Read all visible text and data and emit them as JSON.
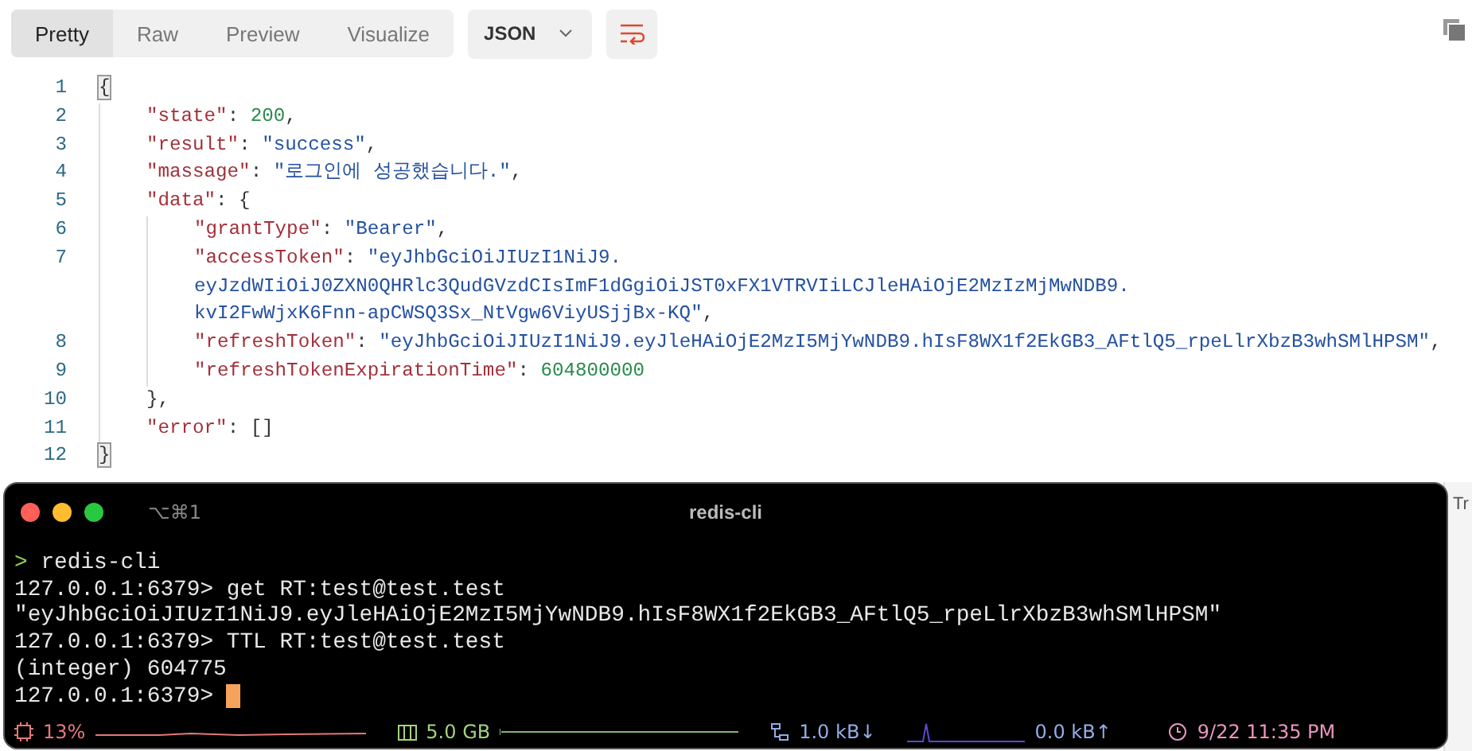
{
  "response_toolbar": {
    "tabs": [
      {
        "label": "Pretty",
        "selected": true
      },
      {
        "label": "Raw",
        "selected": false
      },
      {
        "label": "Preview",
        "selected": false
      },
      {
        "label": "Visualize",
        "selected": false
      }
    ],
    "format": {
      "value": "JSON"
    }
  },
  "code": {
    "lines": [
      {
        "number": "1",
        "segments": [
          {
            "tokens": [
              {
                "kind": "punct",
                "text": "{",
                "highlighted": true
              }
            ]
          }
        ],
        "children": [
          {
            "number": "2",
            "segments": [
              {
                "tokens": [
                  {
                    "kind": "key",
                    "text": "\"state\""
                  },
                  {
                    "kind": "punct",
                    "text": ": "
                  },
                  {
                    "kind": "number",
                    "text": "200"
                  },
                  {
                    "kind": "punct",
                    "text": ","
                  }
                ]
              }
            ]
          },
          {
            "number": "3",
            "segments": [
              {
                "tokens": [
                  {
                    "kind": "key",
                    "text": "\"result\""
                  },
                  {
                    "kind": "punct",
                    "text": ": "
                  },
                  {
                    "kind": "string",
                    "text": "\"success\""
                  },
                  {
                    "kind": "punct",
                    "text": ","
                  }
                ]
              }
            ]
          },
          {
            "number": "4",
            "segments": [
              {
                "tokens": [
                  {
                    "kind": "key",
                    "text": "\"massage\""
                  },
                  {
                    "kind": "punct",
                    "text": ": "
                  },
                  {
                    "kind": "string",
                    "text": "\"로그인에 성공했습니다.\""
                  },
                  {
                    "kind": "punct",
                    "text": ","
                  }
                ]
              }
            ]
          },
          {
            "number": "5",
            "segments": [
              {
                "tokens": [
                  {
                    "kind": "key",
                    "text": "\"data\""
                  },
                  {
                    "kind": "punct",
                    "text": ": {"
                  }
                ]
              }
            ],
            "children": [
              {
                "number": "6",
                "segments": [
                  {
                    "tokens": [
                      {
                        "kind": "key",
                        "text": "\"grantType\""
                      },
                      {
                        "kind": "punct",
                        "text": ": "
                      },
                      {
                        "kind": "string",
                        "text": "\"Bearer\""
                      },
                      {
                        "kind": "punct",
                        "text": ","
                      }
                    ]
                  }
                ]
              },
              {
                "number": "7",
                "segments": [
                  {
                    "tokens": [
                      {
                        "kind": "key",
                        "text": "\"accessToken\""
                      },
                      {
                        "kind": "punct",
                        "text": ": "
                      },
                      {
                        "kind": "string",
                        "text": "\"eyJhbGciOiJIUzI1NiJ9."
                      }
                    ]
                  },
                  {
                    "tokens": [
                      {
                        "kind": "string",
                        "text": "eyJzdWIiOiJ0ZXN0QHRlc3QudGVzdCIsImF1dGgiOiJST0xFX1VTRVIiLCJleHAiOjE2MzIzMjMwNDB9."
                      }
                    ]
                  },
                  {
                    "tokens": [
                      {
                        "kind": "string",
                        "text": "kvI2FwWjxK6Fnn-apCWSQ3Sx_NtVgw6ViyUSjjBx-KQ\""
                      },
                      {
                        "kind": "punct",
                        "text": ","
                      }
                    ]
                  }
                ]
              },
              {
                "number": "8",
                "segments": [
                  {
                    "tokens": [
                      {
                        "kind": "key",
                        "text": "\"refreshToken\""
                      },
                      {
                        "kind": "punct",
                        "text": ": "
                      },
                      {
                        "kind": "string",
                        "text": "\"eyJhbGciOiJIUzI1NiJ9.eyJleHAiOjE2MzI5MjYwNDB9.hIsF8WX1f2EkGB3_AFtlQ5_rpeLlrXbzB3whSMlHPSM\""
                      },
                      {
                        "kind": "punct",
                        "text": ","
                      }
                    ]
                  }
                ]
              },
              {
                "number": "9",
                "segments": [
                  {
                    "tokens": [
                      {
                        "kind": "key",
                        "text": "\"refreshTokenExpirationTime\""
                      },
                      {
                        "kind": "punct",
                        "text": ": "
                      },
                      {
                        "kind": "number",
                        "text": "604800000"
                      }
                    ]
                  }
                ]
              }
            ]
          },
          {
            "number": "10",
            "segments": [
              {
                "tokens": [
                  {
                    "kind": "punct",
                    "text": "},"
                  }
                ]
              }
            ]
          },
          {
            "number": "11",
            "segments": [
              {
                "tokens": [
                  {
                    "kind": "key",
                    "text": "\"error\""
                  },
                  {
                    "kind": "punct",
                    "text": ": []"
                  }
                ]
              }
            ]
          }
        ]
      },
      {
        "number": "12",
        "segments": [
          {
            "tokens": [
              {
                "kind": "punct",
                "text": "}",
                "highlighted": true
              }
            ]
          }
        ]
      }
    ]
  },
  "terminal": {
    "shortcut": "⌥⌘1",
    "title": "redis-cli",
    "lines": [
      {
        "kind": "shell",
        "prompt": ">",
        "text": "redis-cli"
      },
      {
        "kind": "redis",
        "prompt": "127.0.0.1:6379>",
        "text": "get RT:test@test.test"
      },
      {
        "kind": "output",
        "text": "\"eyJhbGciOiJIUzI1NiJ9.eyJleHAiOjE2MzI5MjYwNDB9.hIsF8WX1f2EkGB3_AFtlQ5_rpeLlrXbzB3whSMlHPSM\""
      },
      {
        "kind": "redis",
        "prompt": "127.0.0.1:6379>",
        "text": "TTL RT:test@test.test"
      },
      {
        "kind": "output",
        "text": "(integer) 604775"
      },
      {
        "kind": "redis",
        "prompt": "127.0.0.1:6379>",
        "cursor": true
      }
    ],
    "status_bar": {
      "cpu": "13%",
      "memory": "5.0 GB",
      "download": "1.0 kB↓",
      "upload": "0.0 kB↑",
      "clock": "9/22 11:35 PM"
    }
  },
  "behind_window_text": "Tr"
}
